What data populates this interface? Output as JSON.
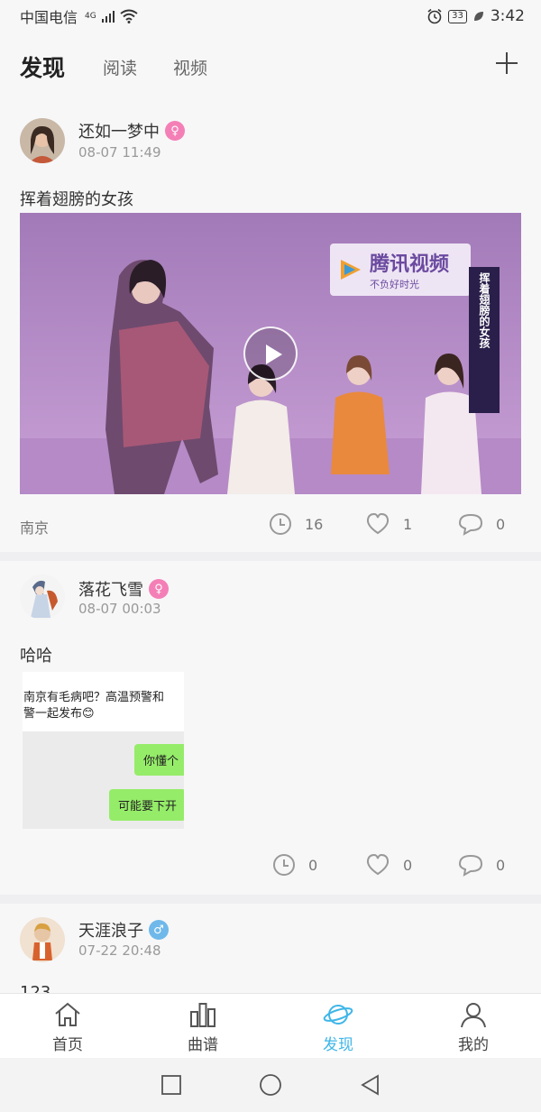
{
  "status_bar": {
    "carrier": "中国电信",
    "network": "4G",
    "battery": "33",
    "time": "3:42"
  },
  "top_nav": {
    "tabs": [
      "发现",
      "阅读",
      "视频"
    ],
    "active_tab": "发现"
  },
  "posts": [
    {
      "username": "还如一梦中",
      "gender": "female",
      "date": "08-07 11:49",
      "text": "挥着翅膀的女孩",
      "video": {
        "logo_title": "腾讯视频",
        "logo_slogan": "不负好时光",
        "banner_text": "挥着翅膀的女孩"
      },
      "location": "南京",
      "views": "16",
      "likes": "1",
      "comments": "0"
    },
    {
      "username": "落花飞雪",
      "gender": "female",
      "date": "08-07 00:03",
      "text": "哈哈",
      "image": {
        "line1": "南京有毛病吧？高温预警和",
        "line2": "警一起发布😊",
        "bubble1": "你懂个",
        "bubble2": "可能要下开"
      },
      "views": "0",
      "likes": "0",
      "comments": "0"
    },
    {
      "username": "天涯浪子",
      "gender": "male",
      "date": "07-22 20:48",
      "text": "123"
    }
  ],
  "bottom_nav": {
    "items": [
      "首页",
      "曲谱",
      "发现",
      "我的"
    ],
    "active": "发现",
    "active_color": "#3fb6e8"
  },
  "icons": {
    "female": "♀",
    "male": "♂"
  }
}
